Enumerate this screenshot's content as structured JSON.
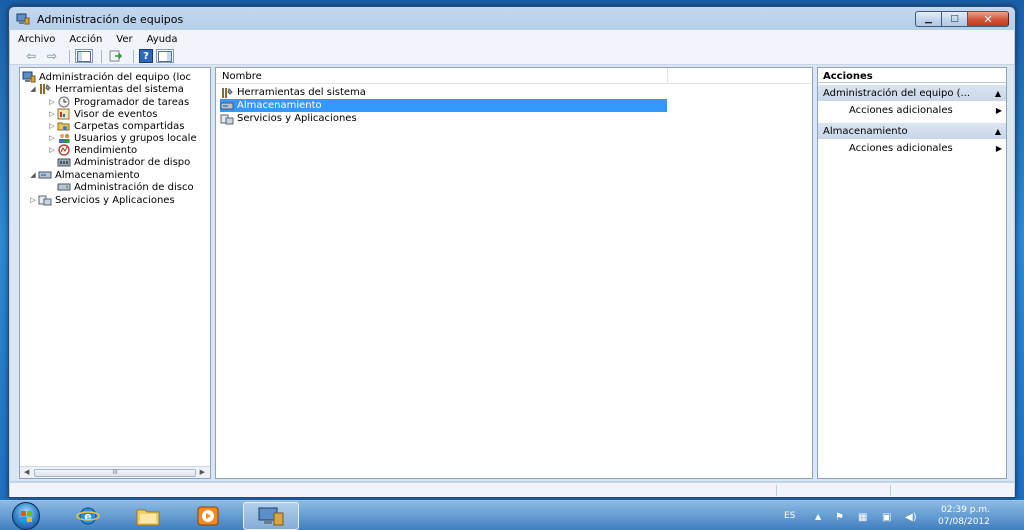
{
  "window": {
    "title": "Administración de equipos",
    "minimize_glyph": "▁",
    "maximize_glyph": "□",
    "close_glyph": "✕"
  },
  "menu": [
    "Archivo",
    "Acción",
    "Ver",
    "Ayuda"
  ],
  "toolbar": {
    "back_glyph": "⇦",
    "forward_glyph": "⇨",
    "help_glyph": "?",
    "icons": [
      "back-icon",
      "forward-icon",
      "show-hide-tree-icon",
      "export-list-icon",
      "help-icon",
      "show-hide-action-icon"
    ]
  },
  "tree": {
    "items": [
      {
        "label": "Administración del equipo (loc",
        "icon": "computer-management-icon",
        "twist": ""
      },
      {
        "label": "Herramientas del sistema",
        "icon": "tools-icon",
        "twist": "◢"
      },
      {
        "label": "Programador de tareas",
        "icon": "clock-icon",
        "twist": "▷"
      },
      {
        "label": "Visor de eventos",
        "icon": "event-viewer-icon",
        "twist": "▷"
      },
      {
        "label": "Carpetas compartidas",
        "icon": "shared-folder-icon",
        "twist": "▷"
      },
      {
        "label": "Usuarios y grupos locale",
        "icon": "users-icon",
        "twist": "▷"
      },
      {
        "label": "Rendimiento",
        "icon": "performance-icon",
        "twist": "▷"
      },
      {
        "label": "Administrador de dispo",
        "icon": "device-manager-icon",
        "twist": ""
      },
      {
        "label": "Almacenamiento",
        "icon": "storage-icon",
        "twist": "◢"
      },
      {
        "label": "Administración de disco",
        "icon": "disk-icon",
        "twist": ""
      },
      {
        "label": "Servicios y Aplicaciones",
        "icon": "services-icon",
        "twist": "▷"
      }
    ],
    "scroll_left": "◀",
    "scroll_right": "▶",
    "thumb_grip": "III"
  },
  "list": {
    "column_header": "Nombre",
    "rows": [
      {
        "label": "Herramientas del sistema",
        "icon": "tools-icon"
      },
      {
        "label": "Almacenamiento",
        "icon": "storage-icon"
      },
      {
        "label": "Servicios y Aplicaciones",
        "icon": "services-icon"
      }
    ]
  },
  "actions": {
    "title": "Acciones",
    "sections": [
      {
        "label": "Administración del equipo (...",
        "collapse_glyph": "▲",
        "link": "Acciones adicionales",
        "link_arrow": "▶"
      },
      {
        "label": "Almacenamiento",
        "collapse_glyph": "▲",
        "link": "Acciones adicionales",
        "link_arrow": "▶"
      }
    ]
  },
  "taskbar": {
    "apps": [
      "windows-explorer-icon",
      "internet-explorer-icon",
      "media-player-icon",
      "computer-management-icon"
    ],
    "language": "ES",
    "time": "02:39 p.m.",
    "date": "07/08/2012",
    "tray_icons": [
      "show-hidden-icons",
      "flag-icon",
      "network-icon",
      "monitor-icon",
      "volume-icon"
    ]
  }
}
